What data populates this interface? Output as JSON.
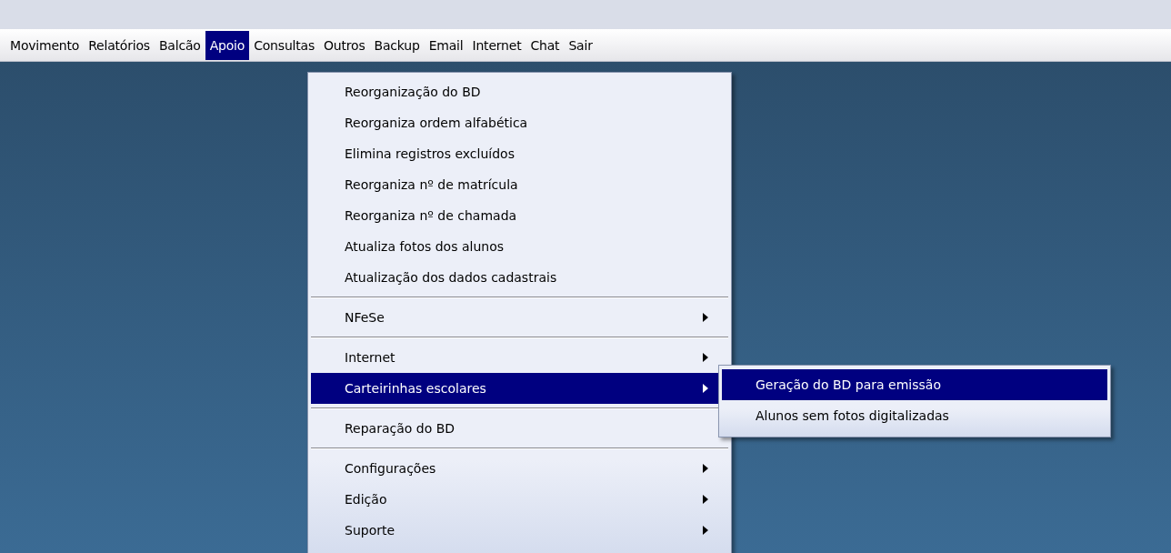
{
  "menu_bar": [
    {
      "label": "Movimento",
      "selected": false
    },
    {
      "label": "Relatórios",
      "selected": false
    },
    {
      "label": "Balcão",
      "selected": false
    },
    {
      "label": "Apoio",
      "selected": true
    },
    {
      "label": "Consultas",
      "selected": false
    },
    {
      "label": "Outros",
      "selected": false
    },
    {
      "label": "Backup",
      "selected": false
    },
    {
      "label": "Email",
      "selected": false
    },
    {
      "label": "Internet",
      "selected": false
    },
    {
      "label": "Chat",
      "selected": false
    },
    {
      "label": "Sair",
      "selected": false
    }
  ],
  "menu": {
    "items": [
      {
        "kind": "command",
        "label": "Reorganização do BD",
        "selected": false
      },
      {
        "kind": "command",
        "label": "Reorganiza ordem alfabética",
        "selected": false
      },
      {
        "kind": "command",
        "label": "Elimina registros excluídos",
        "selected": false
      },
      {
        "kind": "command",
        "label": "Reorganiza nº de matrícula",
        "selected": false
      },
      {
        "kind": "command",
        "label": "Reorganiza nº de chamada",
        "selected": false
      },
      {
        "kind": "command",
        "label": "Atualiza fotos dos alunos",
        "selected": false
      },
      {
        "kind": "command",
        "label": "Atualização dos dados cadastrais",
        "selected": false
      },
      {
        "kind": "separator"
      },
      {
        "kind": "submenu",
        "label": "NFeSe",
        "selected": false
      },
      {
        "kind": "separator"
      },
      {
        "kind": "submenu",
        "label": "Internet",
        "selected": false
      },
      {
        "kind": "submenu",
        "label": "Carteirinhas escolares",
        "selected": true
      },
      {
        "kind": "separator"
      },
      {
        "kind": "command",
        "label": "Reparação do BD",
        "selected": false
      },
      {
        "kind": "separator"
      },
      {
        "kind": "submenu",
        "label": "Configurações",
        "selected": false
      },
      {
        "kind": "submenu",
        "label": "Edição",
        "selected": false
      },
      {
        "kind": "submenu",
        "label": "Suporte",
        "selected": false
      }
    ]
  },
  "submenu": {
    "items": [
      {
        "kind": "command",
        "label": "Geração do BD para emissão",
        "selected": true
      },
      {
        "kind": "command",
        "label": "Alunos sem fotos digitalizadas",
        "selected": false
      }
    ]
  }
}
